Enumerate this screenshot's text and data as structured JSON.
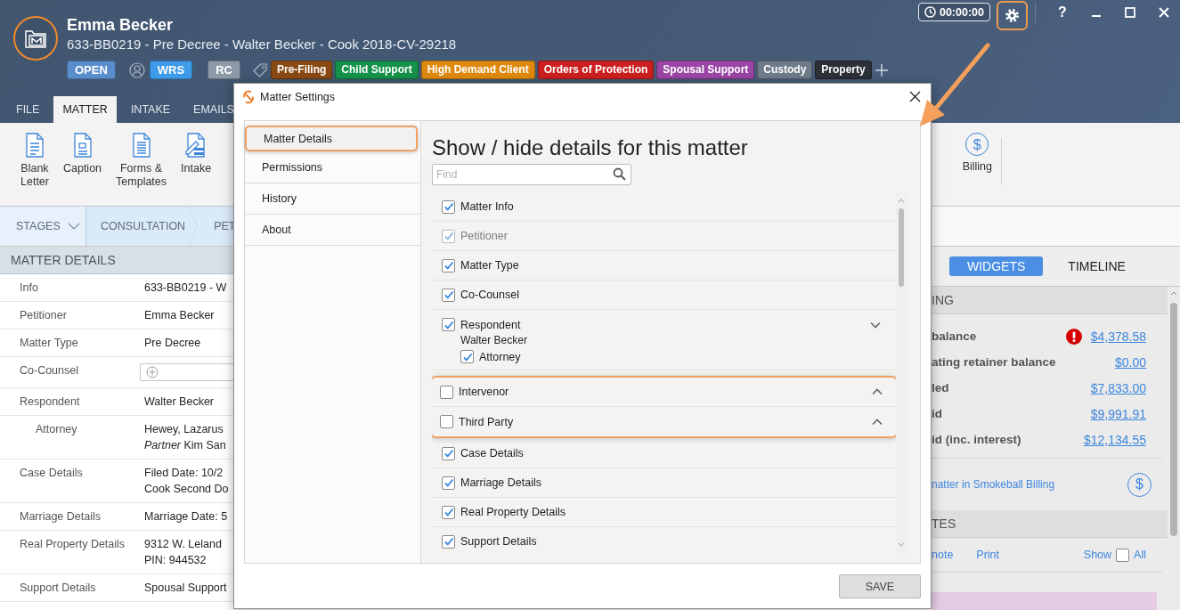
{
  "header": {
    "client_name": "Emma Becker",
    "matter_line": "633-BB0219 - Pre Decree - Walter Becker - Cook 2018-CV-29218",
    "status": "OPEN",
    "staff": [
      {
        "initials": "WRS",
        "color": "#3d9be9"
      },
      {
        "initials": "RC",
        "color": "#8d9aa8"
      }
    ],
    "tags": [
      {
        "label": "Pre-Filing",
        "color": "#8a4a14"
      },
      {
        "label": "Child Support",
        "color": "#14924a"
      },
      {
        "label": "High Demand Client",
        "color": "#df8a0e"
      },
      {
        "label": "Orders of Protection",
        "color": "#cc1f1f"
      },
      {
        "label": "Spousal Support",
        "color": "#9b46a6"
      },
      {
        "label": "Custody",
        "color": "#6e7b89"
      },
      {
        "label": "Property",
        "color": "#2c3037"
      }
    ],
    "timer": "00:00:00",
    "settings_highlighted": true,
    "help": "?"
  },
  "menu_tabs": [
    {
      "label": "FILE",
      "selected": false
    },
    {
      "label": "MATTER",
      "selected": true
    },
    {
      "label": "INTAKE",
      "selected": false
    },
    {
      "label": "EMAILS",
      "selected": false
    }
  ],
  "ribbon": {
    "left": [
      {
        "label": "Blank\nLetter",
        "kind": "letter"
      },
      {
        "label": "Caption",
        "kind": "caption"
      },
      {
        "label": "Forms &\nTemplates",
        "kind": "forms"
      },
      {
        "label": "Intake",
        "kind": "intake"
      }
    ],
    "right": [
      {
        "label": "Billing",
        "glyph": "$"
      }
    ]
  },
  "stages": {
    "menu": "STAGES",
    "items": [
      "CONSULTATION",
      "PET"
    ]
  },
  "matter_details": {
    "title": "MATTER DETAILS",
    "rows": [
      {
        "label": "Info",
        "kind": "text",
        "values": [
          "633-BB0219 - W"
        ]
      },
      {
        "label": "Petitioner",
        "kind": "text",
        "values": [
          "Emma Becker"
        ]
      },
      {
        "label": "Matter Type",
        "kind": "text",
        "values": [
          "Pre Decree"
        ]
      },
      {
        "label": "Co-Counsel",
        "kind": "field"
      },
      {
        "label": "Respondent",
        "kind": "text",
        "values": [
          "Walter Becker"
        ],
        "children": [
          {
            "label": "Attorney",
            "kind": "text",
            "values": [
              "Hewey, Lazarus",
              "*Partner* Kim San"
            ]
          }
        ]
      },
      {
        "label": "Case Details",
        "kind": "text",
        "values": [
          "Filed Date: 10/2",
          "Cook Second Do"
        ]
      },
      {
        "label": "Marriage Details",
        "kind": "text",
        "values": [
          "Marriage Date: 5"
        ]
      },
      {
        "label": "Real Property Details",
        "kind": "text",
        "values": [
          "9312 W. Leland",
          "PIN: 944532"
        ]
      },
      {
        "label": "Support Details",
        "kind": "text",
        "values": [
          "Spousal Support"
        ]
      }
    ]
  },
  "widgets": {
    "tabs": [
      {
        "label": "WIDGETS",
        "selected": true
      },
      {
        "label": "TIMELINE",
        "selected": false
      }
    ],
    "billing": {
      "title": "ING",
      "rows": [
        {
          "label": "balance",
          "amount": "$4,378.58",
          "alert": true
        },
        {
          "label": "ating retainer balance",
          "amount": "$0.00",
          "alert": false
        },
        {
          "label": "led",
          "amount": "$7,833.00",
          "alert": false
        },
        {
          "label": "id",
          "amount": "$9,991.91",
          "alert": false
        },
        {
          "label": "id (inc. interest)",
          "amount": "$12,134.55",
          "alert": false
        }
      ],
      "link": "natter in Smokeball Billing",
      "link_glyph": "$"
    },
    "notes": {
      "title": "TES",
      "actions": [
        "note",
        "Print"
      ],
      "show": "Show",
      "show_all": false,
      "all": "All"
    }
  },
  "dialog": {
    "title": "Matter Settings",
    "nav": [
      {
        "label": "Matter Details",
        "selected": true
      },
      {
        "label": "Permissions",
        "selected": false
      },
      {
        "label": "History",
        "selected": false
      },
      {
        "label": "About",
        "selected": false
      }
    ],
    "heading": "Show / hide details for this matter",
    "search": {
      "placeholder": "Find"
    },
    "items": [
      {
        "label": "Matter Info",
        "checked": true,
        "disabled": false,
        "highlighted": false
      },
      {
        "label": "Petitioner",
        "checked": true,
        "disabled": true,
        "highlighted": false
      },
      {
        "label": "Matter Type",
        "checked": true,
        "disabled": false,
        "highlighted": false
      },
      {
        "label": "Co-Counsel",
        "checked": true,
        "disabled": false,
        "highlighted": false
      },
      {
        "label": "Respondent",
        "checked": true,
        "disabled": false,
        "highlighted": false,
        "kind": "group",
        "expanded": true,
        "party": "Walter Becker",
        "children": [
          {
            "label": "Attorney",
            "checked": true,
            "disabled": false
          }
        ]
      },
      {
        "label": "Intervenor",
        "checked": false,
        "disabled": false,
        "highlighted": true,
        "kind": "group",
        "expanded": false
      },
      {
        "label": "Third Party",
        "checked": false,
        "disabled": false,
        "highlighted": true,
        "kind": "group",
        "expanded": false
      },
      {
        "label": "Case Details",
        "checked": true,
        "disabled": false,
        "highlighted": false
      },
      {
        "label": "Marriage Details",
        "checked": true,
        "disabled": false,
        "highlighted": false
      },
      {
        "label": "Real Property Details",
        "checked": true,
        "disabled": false,
        "highlighted": false
      },
      {
        "label": "Support Details",
        "checked": true,
        "disabled": false,
        "highlighted": false
      }
    ],
    "save": "SAVE"
  }
}
